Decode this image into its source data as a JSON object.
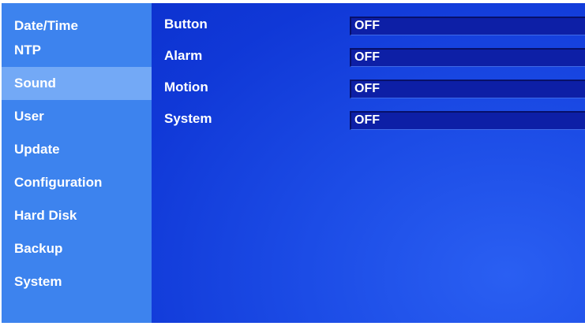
{
  "sidebar": {
    "items": [
      {
        "label": "Date/Time"
      },
      {
        "label": "NTP"
      },
      {
        "label": "Sound",
        "selected": true
      },
      {
        "label": "User"
      },
      {
        "label": "Update"
      },
      {
        "label": "Configuration"
      },
      {
        "label": "Hard Disk"
      },
      {
        "label": "Backup"
      },
      {
        "label": "System"
      }
    ]
  },
  "sound_settings": {
    "rows": [
      {
        "label": "Button",
        "value": "OFF"
      },
      {
        "label": "Alarm",
        "value": "OFF"
      },
      {
        "label": "Motion",
        "value": "OFF"
      },
      {
        "label": "System",
        "value": "OFF"
      }
    ]
  },
  "colors": {
    "sidebar_bg": "#3d83ee",
    "sidebar_selected": "#73a9f6",
    "panel_bg": "#1c4ce6",
    "field_bg": "#0d1fa6",
    "text": "#ffffff"
  }
}
